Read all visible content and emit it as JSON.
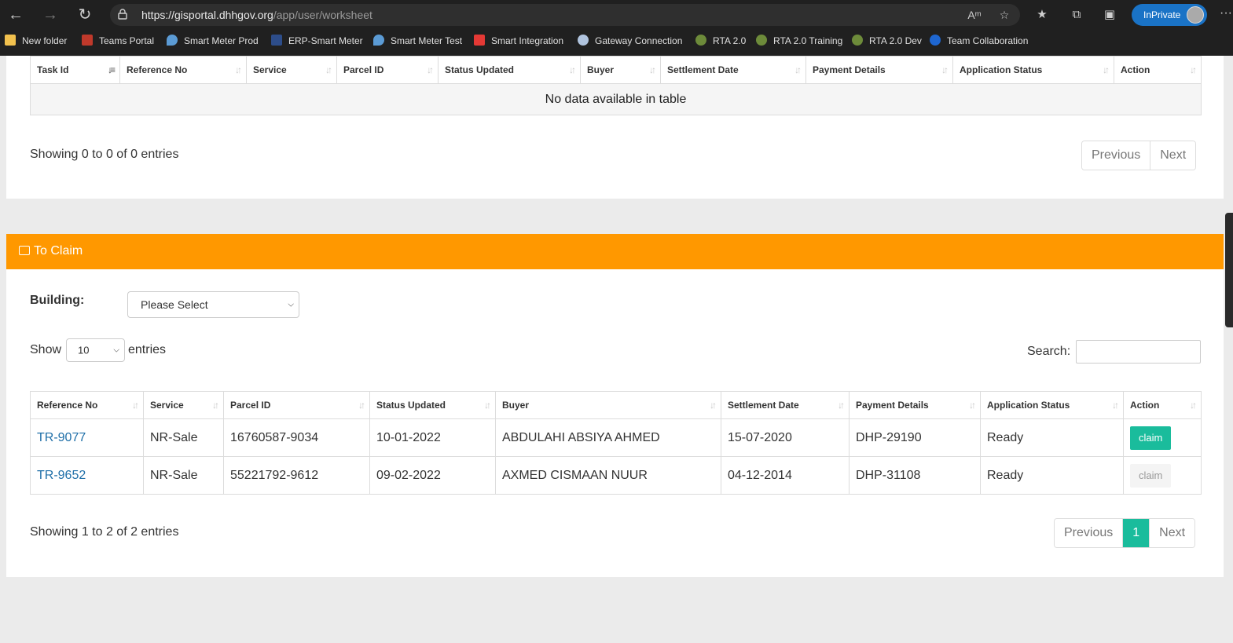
{
  "browser": {
    "url_host": "https://gisportal.dhhgov.org",
    "url_path": "/app/user/worksheet",
    "inprivate_label": "InPrivate",
    "bookmarks": [
      {
        "label": "New folder",
        "color": "#f2c14e"
      },
      {
        "label": "Teams Portal",
        "color": "#c0392b"
      },
      {
        "label": "Smart Meter Prod",
        "color": "#5b9bd5"
      },
      {
        "label": "ERP-Smart Meter",
        "color": "#2d4d8a"
      },
      {
        "label": "Smart Meter Test",
        "color": "#5b9bd5"
      },
      {
        "label": "Smart Integration",
        "color": "#e53935"
      },
      {
        "label": "Gateway Connection",
        "color": "#b0c4de"
      },
      {
        "label": "RTA 2.0",
        "color": "#6d8b3a"
      },
      {
        "label": "RTA 2.0 Training",
        "color": "#6d8b3a"
      },
      {
        "label": "RTA 2.0 Dev",
        "color": "#6d8b3a"
      },
      {
        "label": "Team Collaboration",
        "color": "#1e66d0"
      }
    ]
  },
  "top_table": {
    "columns": [
      "Task Id",
      "Reference No",
      "Service",
      "Parcel ID",
      "Status Updated",
      "Buyer",
      "Settlement Date",
      "Payment Details",
      "Application Status",
      "Action"
    ],
    "empty_message": "No data available in table",
    "info": "Showing 0 to 0 of 0 entries",
    "prev_label": "Previous",
    "next_label": "Next"
  },
  "claim_section": {
    "title": "To Claim",
    "accent_color": "#ff9800",
    "building_label": "Building:",
    "building_selected": "Please Select",
    "show_label": "Show",
    "show_value": "10",
    "entries_label": "entries",
    "search_label": "Search:",
    "columns": [
      "Reference No",
      "Service",
      "Parcel ID",
      "Status Updated",
      "Buyer",
      "Settlement Date",
      "Payment Details",
      "Application Status",
      "Action"
    ],
    "rows": [
      {
        "ref": "TR-9077",
        "service": "NR-Sale",
        "parcel": "16760587-9034",
        "status_updated": "10-01-2022",
        "buyer": "ABDULAHI ABSIYA AHMED",
        "settlement": "15-07-2020",
        "payment": "DHP-29190",
        "app_status": "Ready",
        "action": "claim"
      },
      {
        "ref": "TR-9652",
        "service": "NR-Sale",
        "parcel": "55221792-9612",
        "status_updated": "09-02-2022",
        "buyer": "AXMED CISMAAN NUUR",
        "settlement": "04-12-2014",
        "payment": "DHP-31108",
        "app_status": "Ready",
        "action": "claim"
      }
    ],
    "info": "Showing 1 to 2 of 2 entries",
    "prev_label": "Previous",
    "current_page": "1",
    "next_label": "Next",
    "button_color": "#1abc9c"
  }
}
